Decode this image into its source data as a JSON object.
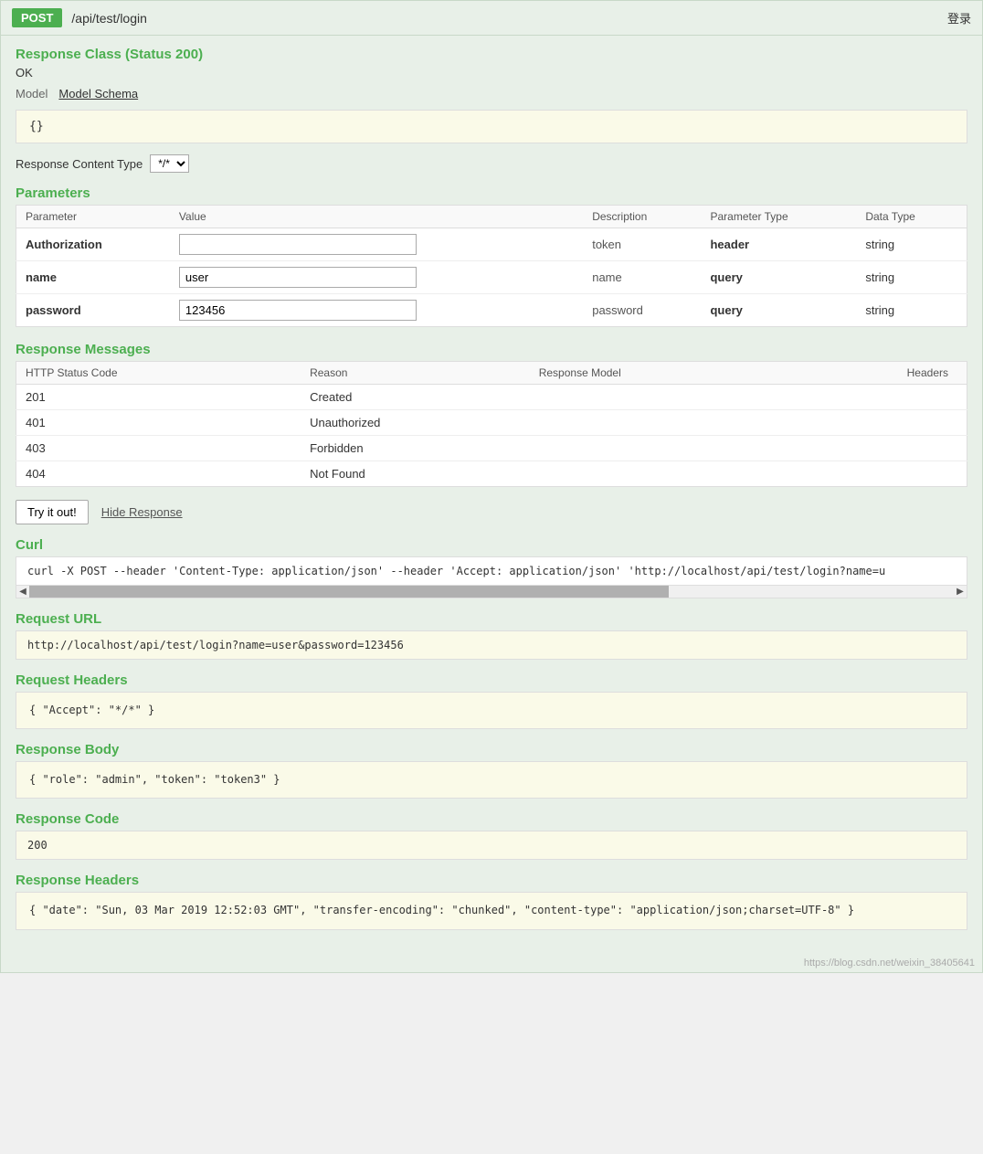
{
  "header": {
    "method": "POST",
    "path": "/api/test/login",
    "login_text": "登录"
  },
  "response_class": {
    "title": "Response Class (Status 200)",
    "status_text": "OK",
    "model_label": "Model",
    "model_schema_label": "Model Schema",
    "model_json": "{}"
  },
  "response_content_type": {
    "label": "Response Content Type",
    "value": "*/*"
  },
  "parameters": {
    "title": "Parameters",
    "columns": {
      "parameter": "Parameter",
      "value": "Value",
      "description": "Description",
      "parameter_type": "Parameter Type",
      "data_type": "Data Type"
    },
    "rows": [
      {
        "name": "Authorization",
        "value": "",
        "placeholder": "",
        "description": "token",
        "parameter_type": "header",
        "data_type": "string"
      },
      {
        "name": "name",
        "value": "user",
        "placeholder": "",
        "description": "name",
        "parameter_type": "query",
        "data_type": "string"
      },
      {
        "name": "password",
        "value": "123456",
        "placeholder": "",
        "description": "password",
        "parameter_type": "query",
        "data_type": "string"
      }
    ]
  },
  "response_messages": {
    "title": "Response Messages",
    "columns": {
      "http_status_code": "HTTP Status Code",
      "reason": "Reason",
      "response_model": "Response Model",
      "headers": "Headers"
    },
    "rows": [
      {
        "code": "201",
        "reason": "Created",
        "model": "",
        "headers": ""
      },
      {
        "code": "401",
        "reason": "Unauthorized",
        "model": "",
        "headers": ""
      },
      {
        "code": "403",
        "reason": "Forbidden",
        "model": "",
        "headers": ""
      },
      {
        "code": "404",
        "reason": "Not Found",
        "model": "",
        "headers": ""
      }
    ]
  },
  "buttons": {
    "try_it_out": "Try it out!",
    "hide_response": "Hide Response"
  },
  "curl": {
    "title": "Curl",
    "value": "curl -X POST --header 'Content-Type: application/json' --header 'Accept: application/json' 'http://localhost/api/test/login?name=u"
  },
  "request_url": {
    "title": "Request URL",
    "value": "http://localhost/api/test/login?name=user&password=123456"
  },
  "request_headers": {
    "title": "Request Headers",
    "value": "{\n  \"Accept\": \"*/*\"\n}"
  },
  "response_body": {
    "title": "Response Body",
    "value": "{\n  \"role\": \"admin\",\n  \"token\": \"token3\"\n}"
  },
  "response_code": {
    "title": "Response Code",
    "value": "200"
  },
  "response_headers": {
    "title": "Response Headers",
    "value": "{\n  \"date\": \"Sun, 03 Mar 2019 12:52:03 GMT\",\n  \"transfer-encoding\": \"chunked\",\n  \"content-type\": \"application/json;charset=UTF-8\"\n}"
  },
  "watermark": {
    "text": "https://blog.csdn.net/weixin_38405641"
  }
}
